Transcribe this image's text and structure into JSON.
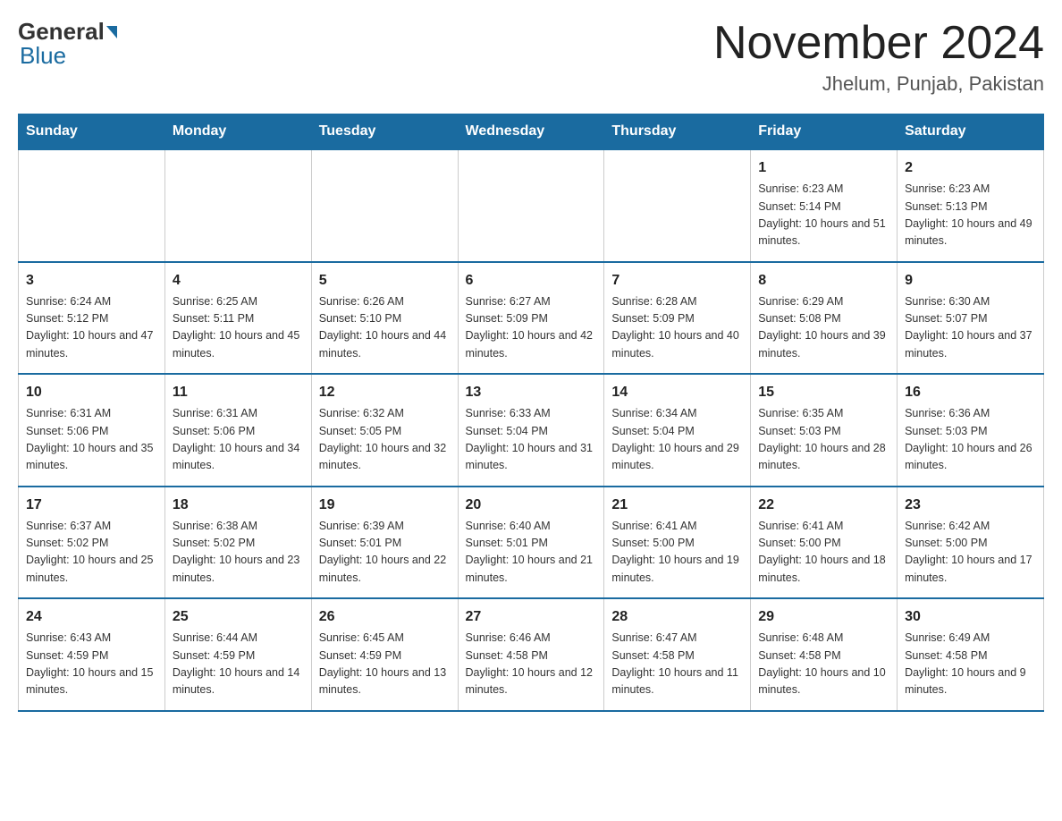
{
  "header": {
    "logo_general": "General",
    "logo_blue": "Blue",
    "month_title": "November 2024",
    "location": "Jhelum, Punjab, Pakistan"
  },
  "weekdays": [
    "Sunday",
    "Monday",
    "Tuesday",
    "Wednesday",
    "Thursday",
    "Friday",
    "Saturday"
  ],
  "weeks": [
    [
      {
        "day": "",
        "sunrise": "",
        "sunset": "",
        "daylight": ""
      },
      {
        "day": "",
        "sunrise": "",
        "sunset": "",
        "daylight": ""
      },
      {
        "day": "",
        "sunrise": "",
        "sunset": "",
        "daylight": ""
      },
      {
        "day": "",
        "sunrise": "",
        "sunset": "",
        "daylight": ""
      },
      {
        "day": "",
        "sunrise": "",
        "sunset": "",
        "daylight": ""
      },
      {
        "day": "1",
        "sunrise": "Sunrise: 6:23 AM",
        "sunset": "Sunset: 5:14 PM",
        "daylight": "Daylight: 10 hours and 51 minutes."
      },
      {
        "day": "2",
        "sunrise": "Sunrise: 6:23 AM",
        "sunset": "Sunset: 5:13 PM",
        "daylight": "Daylight: 10 hours and 49 minutes."
      }
    ],
    [
      {
        "day": "3",
        "sunrise": "Sunrise: 6:24 AM",
        "sunset": "Sunset: 5:12 PM",
        "daylight": "Daylight: 10 hours and 47 minutes."
      },
      {
        "day": "4",
        "sunrise": "Sunrise: 6:25 AM",
        "sunset": "Sunset: 5:11 PM",
        "daylight": "Daylight: 10 hours and 45 minutes."
      },
      {
        "day": "5",
        "sunrise": "Sunrise: 6:26 AM",
        "sunset": "Sunset: 5:10 PM",
        "daylight": "Daylight: 10 hours and 44 minutes."
      },
      {
        "day": "6",
        "sunrise": "Sunrise: 6:27 AM",
        "sunset": "Sunset: 5:09 PM",
        "daylight": "Daylight: 10 hours and 42 minutes."
      },
      {
        "day": "7",
        "sunrise": "Sunrise: 6:28 AM",
        "sunset": "Sunset: 5:09 PM",
        "daylight": "Daylight: 10 hours and 40 minutes."
      },
      {
        "day": "8",
        "sunrise": "Sunrise: 6:29 AM",
        "sunset": "Sunset: 5:08 PM",
        "daylight": "Daylight: 10 hours and 39 minutes."
      },
      {
        "day": "9",
        "sunrise": "Sunrise: 6:30 AM",
        "sunset": "Sunset: 5:07 PM",
        "daylight": "Daylight: 10 hours and 37 minutes."
      }
    ],
    [
      {
        "day": "10",
        "sunrise": "Sunrise: 6:31 AM",
        "sunset": "Sunset: 5:06 PM",
        "daylight": "Daylight: 10 hours and 35 minutes."
      },
      {
        "day": "11",
        "sunrise": "Sunrise: 6:31 AM",
        "sunset": "Sunset: 5:06 PM",
        "daylight": "Daylight: 10 hours and 34 minutes."
      },
      {
        "day": "12",
        "sunrise": "Sunrise: 6:32 AM",
        "sunset": "Sunset: 5:05 PM",
        "daylight": "Daylight: 10 hours and 32 minutes."
      },
      {
        "day": "13",
        "sunrise": "Sunrise: 6:33 AM",
        "sunset": "Sunset: 5:04 PM",
        "daylight": "Daylight: 10 hours and 31 minutes."
      },
      {
        "day": "14",
        "sunrise": "Sunrise: 6:34 AM",
        "sunset": "Sunset: 5:04 PM",
        "daylight": "Daylight: 10 hours and 29 minutes."
      },
      {
        "day": "15",
        "sunrise": "Sunrise: 6:35 AM",
        "sunset": "Sunset: 5:03 PM",
        "daylight": "Daylight: 10 hours and 28 minutes."
      },
      {
        "day": "16",
        "sunrise": "Sunrise: 6:36 AM",
        "sunset": "Sunset: 5:03 PM",
        "daylight": "Daylight: 10 hours and 26 minutes."
      }
    ],
    [
      {
        "day": "17",
        "sunrise": "Sunrise: 6:37 AM",
        "sunset": "Sunset: 5:02 PM",
        "daylight": "Daylight: 10 hours and 25 minutes."
      },
      {
        "day": "18",
        "sunrise": "Sunrise: 6:38 AM",
        "sunset": "Sunset: 5:02 PM",
        "daylight": "Daylight: 10 hours and 23 minutes."
      },
      {
        "day": "19",
        "sunrise": "Sunrise: 6:39 AM",
        "sunset": "Sunset: 5:01 PM",
        "daylight": "Daylight: 10 hours and 22 minutes."
      },
      {
        "day": "20",
        "sunrise": "Sunrise: 6:40 AM",
        "sunset": "Sunset: 5:01 PM",
        "daylight": "Daylight: 10 hours and 21 minutes."
      },
      {
        "day": "21",
        "sunrise": "Sunrise: 6:41 AM",
        "sunset": "Sunset: 5:00 PM",
        "daylight": "Daylight: 10 hours and 19 minutes."
      },
      {
        "day": "22",
        "sunrise": "Sunrise: 6:41 AM",
        "sunset": "Sunset: 5:00 PM",
        "daylight": "Daylight: 10 hours and 18 minutes."
      },
      {
        "day": "23",
        "sunrise": "Sunrise: 6:42 AM",
        "sunset": "Sunset: 5:00 PM",
        "daylight": "Daylight: 10 hours and 17 minutes."
      }
    ],
    [
      {
        "day": "24",
        "sunrise": "Sunrise: 6:43 AM",
        "sunset": "Sunset: 4:59 PM",
        "daylight": "Daylight: 10 hours and 15 minutes."
      },
      {
        "day": "25",
        "sunrise": "Sunrise: 6:44 AM",
        "sunset": "Sunset: 4:59 PM",
        "daylight": "Daylight: 10 hours and 14 minutes."
      },
      {
        "day": "26",
        "sunrise": "Sunrise: 6:45 AM",
        "sunset": "Sunset: 4:59 PM",
        "daylight": "Daylight: 10 hours and 13 minutes."
      },
      {
        "day": "27",
        "sunrise": "Sunrise: 6:46 AM",
        "sunset": "Sunset: 4:58 PM",
        "daylight": "Daylight: 10 hours and 12 minutes."
      },
      {
        "day": "28",
        "sunrise": "Sunrise: 6:47 AM",
        "sunset": "Sunset: 4:58 PM",
        "daylight": "Daylight: 10 hours and 11 minutes."
      },
      {
        "day": "29",
        "sunrise": "Sunrise: 6:48 AM",
        "sunset": "Sunset: 4:58 PM",
        "daylight": "Daylight: 10 hours and 10 minutes."
      },
      {
        "day": "30",
        "sunrise": "Sunrise: 6:49 AM",
        "sunset": "Sunset: 4:58 PM",
        "daylight": "Daylight: 10 hours and 9 minutes."
      }
    ]
  ]
}
